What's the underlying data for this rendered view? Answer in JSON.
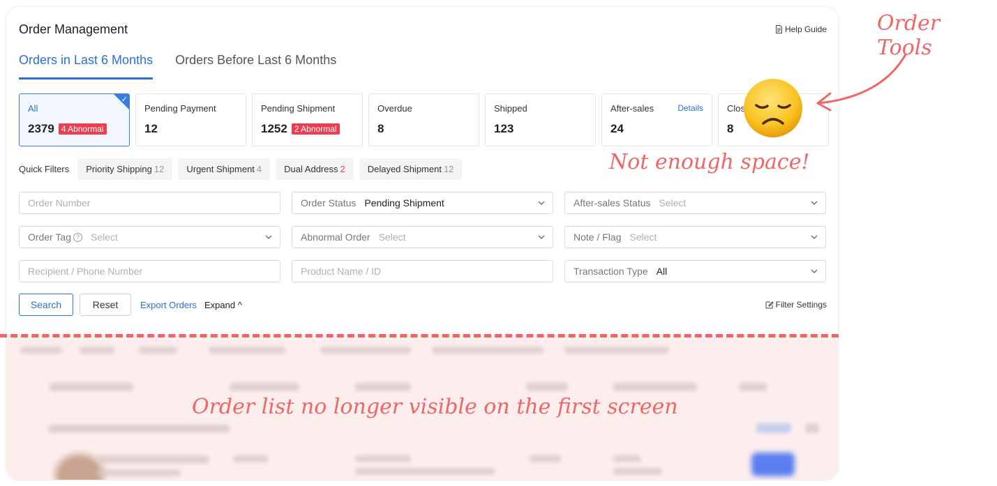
{
  "header": {
    "title": "Order Management",
    "help_label": "Help Guide"
  },
  "tabs": [
    {
      "label": "Orders in Last 6 Months"
    },
    {
      "label": "Orders Before Last 6 Months"
    }
  ],
  "stats": [
    {
      "label": "All",
      "value": "2379",
      "badge": "4 Abnormal"
    },
    {
      "label": "Pending Payment",
      "value": "12"
    },
    {
      "label": "Pending Shipment",
      "value": "1252",
      "badge": "2 Abnormal"
    },
    {
      "label": "Overdue",
      "value": "8"
    },
    {
      "label": "Shipped",
      "value": "123"
    },
    {
      "label": "After-sales",
      "value": "24",
      "link": "Details"
    },
    {
      "label": "Clos",
      "value": "8"
    }
  ],
  "quick_filters": {
    "label": "Quick Filters",
    "chips": [
      {
        "label": "Priority Shipping",
        "count": "12"
      },
      {
        "label": "Urgent Shipment",
        "count": "4"
      },
      {
        "label": "Dual Address",
        "count": "2"
      },
      {
        "label": "Delayed Shipment",
        "count": "12"
      }
    ]
  },
  "filters": {
    "order_number": {
      "placeholder": "Order Number"
    },
    "order_status": {
      "label": "Order Status",
      "value": "Pending Shipment"
    },
    "after_sales_status": {
      "label": "After-sales Status",
      "placeholder": "Select"
    },
    "order_tag": {
      "label": "Order Tag",
      "help": "?",
      "placeholder": "Select"
    },
    "abnormal_order": {
      "label": "Abnormal Order",
      "placeholder": "Select"
    },
    "note_flag": {
      "label": "Note / Flag",
      "placeholder": "Select"
    },
    "recipient": {
      "placeholder": "Recipient / Phone Number"
    },
    "product": {
      "placeholder": "Product Name / ID"
    },
    "transaction_type": {
      "label": "Transaction Type",
      "value": "All"
    }
  },
  "actions": {
    "search": "Search",
    "reset": "Reset",
    "export": "Export Orders",
    "expand": "Expand ^",
    "filter_settings": "Filter Settings"
  },
  "annotations": {
    "order_tools": "Order Tools",
    "not_enough_space": "Not enough space!",
    "list_hidden": "Order list no longer visible on the first screen"
  },
  "colors": {
    "accent": "#2a6fd8",
    "alert": "#ee3d4e",
    "annotation": "#f06565",
    "blur_overlay": "#fdeeee"
  },
  "icons": [
    "document-icon",
    "check-icon",
    "help-circle-icon",
    "chevron-down-icon",
    "edit-icon",
    "arrow-annotation",
    "disappointed-face-emoji"
  ]
}
